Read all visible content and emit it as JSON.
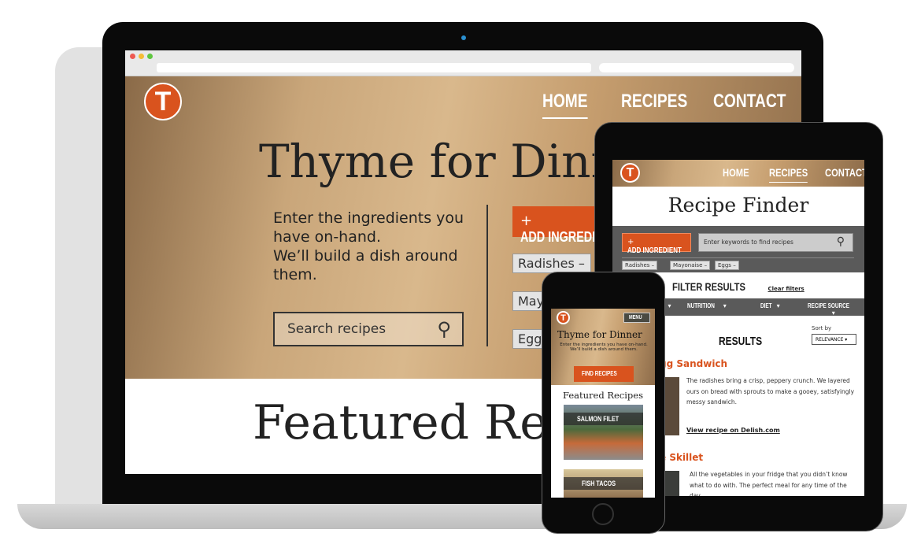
{
  "colors": {
    "accent": "#d9531e",
    "dark_panel": "#5a5a5a"
  },
  "laptop": {
    "nav": [
      "HOME",
      "RECIPES",
      "CONTACT"
    ],
    "logo_letter": "T",
    "hero_title": "Thyme for Dinn",
    "hero_text": [
      "Enter the ingredients you",
      "have on-hand.",
      "We’ll build a dish around",
      "them."
    ],
    "search_placeholder": "Search recipes",
    "add_ingredient": "ADD INGREDI",
    "tags": [
      "Radishes",
      "May",
      "Egg"
    ],
    "featured": "Featured Re"
  },
  "tablet": {
    "nav": [
      "HOME",
      "RECIPES",
      "CONTACT"
    ],
    "logo_letter": "T",
    "title": "Recipe Finder",
    "add_ingredient": "ADD INGREDIENT",
    "search_placeholder": "Enter keywords to find recipes",
    "tags": [
      "Radishes",
      "Mayonaise",
      "Eggs"
    ],
    "filter_title": "FILTER RESULTS",
    "clear_filters": "Clear filters",
    "filters": [
      "",
      "NUTRITION",
      "DIET",
      "RECIPE SOURCE"
    ],
    "results_title": "RESULTS",
    "sort_label": "Sort by",
    "sort_value": "RELEVANCE",
    "results": [
      {
        "title": "gg Sandwich",
        "desc": "The radishes bring a crisp, peppery crunch. We layered ours on bread with sprouts to make a gooey, satisfyingly messy sandwich.",
        "link": "View recipe on Delish.com"
      },
      {
        "title": "e Skillet",
        "desc": "All the vegetables in your fridge that you didn’t know what to do with. The perfect meal for any time of the day.",
        "link": ""
      }
    ]
  },
  "phone": {
    "logo_letter": "T",
    "menu": "MENU",
    "title": "Thyme for Dinner",
    "text": "Enter the ingredients you have on-hand. We’ll build a dish around them.",
    "find_button": "FIND RECIPES",
    "featured": "Featured Recipes",
    "cards": [
      "SALMON FILET",
      "FISH TACOS"
    ]
  }
}
